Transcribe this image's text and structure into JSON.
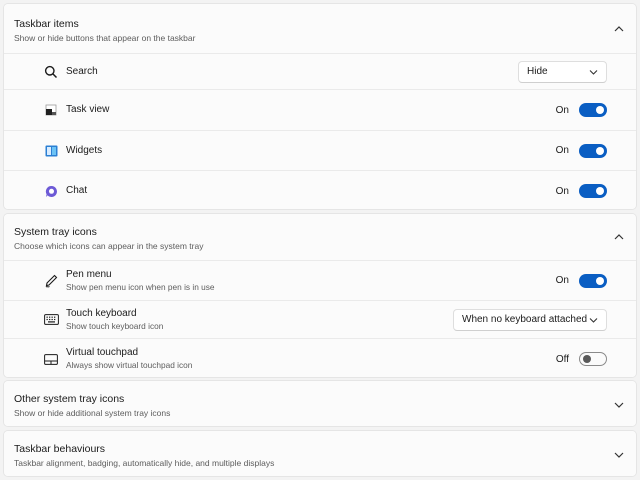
{
  "taskbar_items": {
    "title": "Taskbar items",
    "subtitle": "Show or hide buttons that appear on the taskbar",
    "expanded": true,
    "items": [
      {
        "label": "Search",
        "icon": "search-icon",
        "control": "dropdown",
        "value": "Hide"
      },
      {
        "label": "Task view",
        "icon": "task-view-icon",
        "control": "toggle",
        "state": "On"
      },
      {
        "label": "Widgets",
        "icon": "widgets-icon",
        "control": "toggle",
        "state": "On"
      },
      {
        "label": "Chat",
        "icon": "chat-icon",
        "control": "toggle",
        "state": "On"
      }
    ]
  },
  "system_tray_icons": {
    "title": "System tray icons",
    "subtitle": "Choose which icons can appear in the system tray",
    "expanded": true,
    "items": [
      {
        "label": "Pen menu",
        "description": "Show pen menu icon when pen is in use",
        "icon": "pen-icon",
        "control": "toggle",
        "state": "On"
      },
      {
        "label": "Touch keyboard",
        "description": "Show touch keyboard icon",
        "icon": "keyboard-icon",
        "control": "dropdown",
        "value": "When no keyboard attached"
      },
      {
        "label": "Virtual touchpad",
        "description": "Always show virtual touchpad icon",
        "icon": "touchpad-icon",
        "control": "toggle",
        "state": "Off"
      }
    ]
  },
  "other_system_tray_icons": {
    "title": "Other system tray icons",
    "subtitle": "Show or hide additional system tray icons",
    "expanded": false
  },
  "taskbar_behaviours": {
    "title": "Taskbar behaviours",
    "subtitle": "Taskbar alignment, badging, automatically hide, and multiple displays",
    "expanded": false
  },
  "colors": {
    "accent": "#0a5ec3",
    "background": "#f3f3f3",
    "card": "#fbfbfb"
  }
}
